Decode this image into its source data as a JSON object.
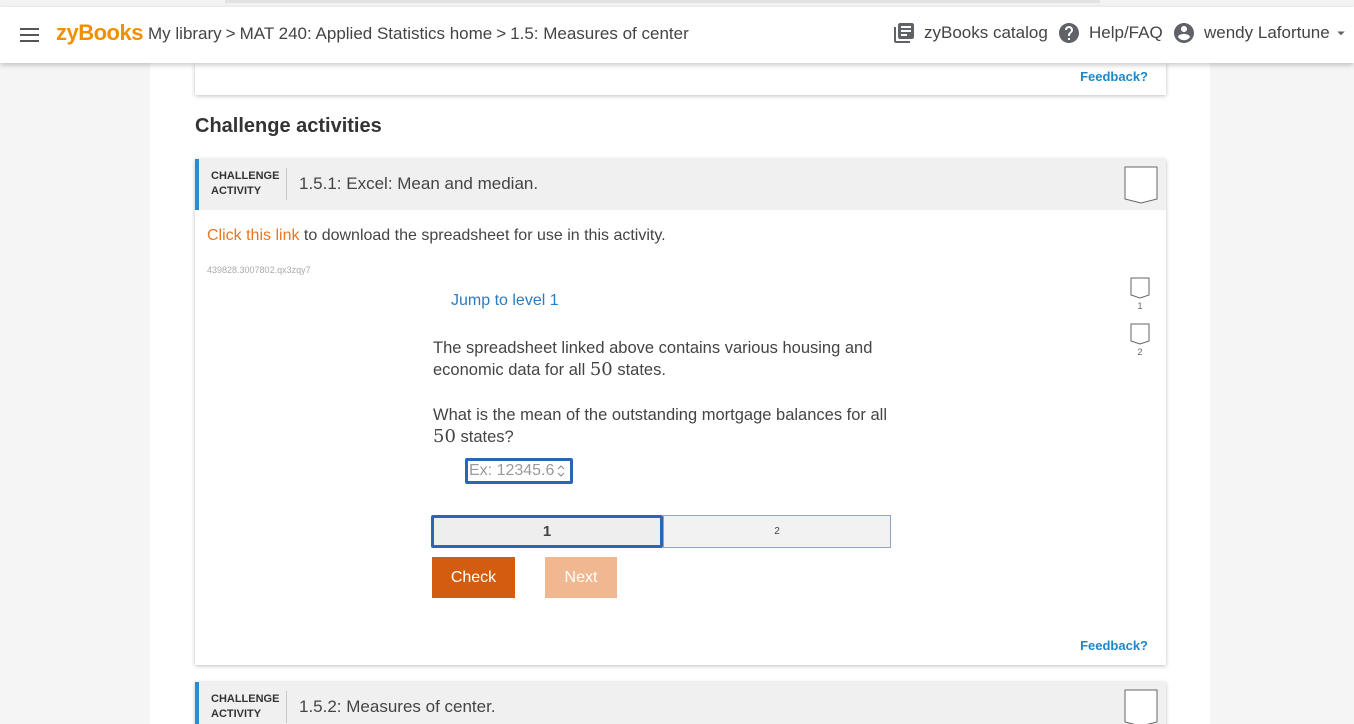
{
  "header": {
    "logo": "zyBooks",
    "breadcrumb": {
      "my_library": "My library",
      "sep": ">",
      "course": "MAT 240: Applied Statistics home",
      "section": "1.5: Measures of center"
    },
    "catalog": "zyBooks catalog",
    "help": "Help/FAQ",
    "user": "wendy Lafortune"
  },
  "feedback_label": "Feedback?",
  "section_title": "Challenge activities",
  "activity1": {
    "tag_line1": "CHALLENGE",
    "tag_line2": "ACTIVITY",
    "title": "1.5.1: Excel: Mean and median.",
    "link_text": "Click this link",
    "link_rest": " to download the spreadsheet for use in this activity.",
    "id_code": "439828.3007802.qx3zqy7",
    "jump": "Jump to level 1",
    "level_badges": [
      "1",
      "2"
    ],
    "q1_part1": "The spreadsheet linked above contains various housing and economic data for all ",
    "q1_num": "50",
    "q1_part2": " states.",
    "q2_part1": "What is the mean of the outstanding mortgage balances for all ",
    "q2_num": "50",
    "q2_part2": " states?",
    "answer_placeholder": "Ex: 12345.6",
    "answer_value": "",
    "levels": [
      "1",
      "2"
    ],
    "active_level": 1,
    "check_label": "Check",
    "next_label": "Next"
  },
  "activity2": {
    "tag_line1": "CHALLENGE",
    "tag_line2": "ACTIVITY",
    "title": "1.5.2: Measures of center."
  },
  "colors": {
    "brand_orange": "#f09000",
    "link_orange": "#e87722",
    "accent_blue": "#2a8ccf",
    "check_button": "#d35c0e",
    "next_button": "#f0b890"
  },
  "icons": [
    "menu-icon",
    "library-icon",
    "help-icon",
    "account-icon",
    "caret-down-icon",
    "completion-badge-icon",
    "spinner-arrows-icon"
  ]
}
